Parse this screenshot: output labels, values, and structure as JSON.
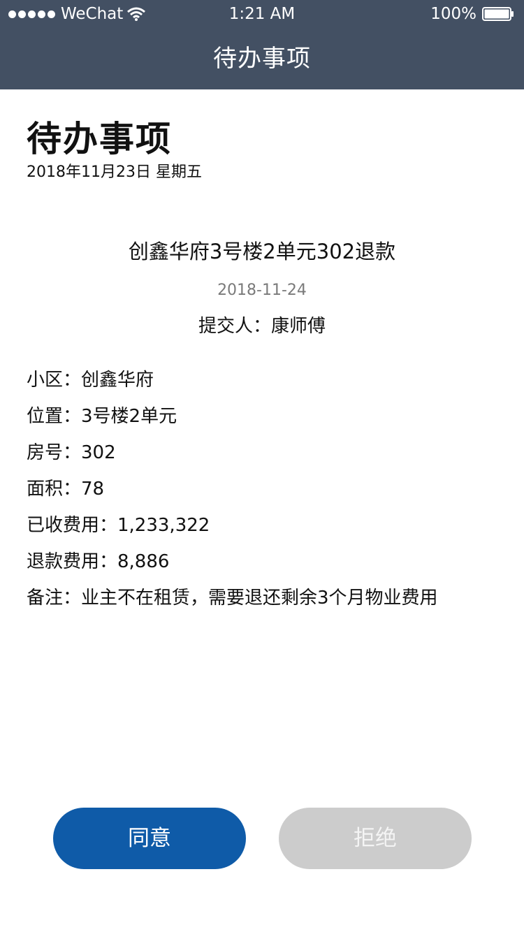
{
  "status_bar": {
    "carrier": "WeChat",
    "time": "1:21 AM",
    "battery": "100%"
  },
  "nav": {
    "title": "待办事项"
  },
  "page": {
    "heading": "待办事项",
    "date": "2018年11月23日 星期五"
  },
  "item": {
    "title": "创鑫华府3号楼2单元302退款",
    "date": "2018-11-24",
    "submitter": "提交人：康师傅"
  },
  "details": [
    "小区：创鑫华府",
    "位置：3号楼2单元",
    "房号：302",
    "面积：78",
    "已收费用：1,233,322",
    "退款费用：8,886",
    "备注：业主不在租赁，需要退还剩余3个月物业费用"
  ],
  "actions": {
    "agree_label": "同意",
    "reject_label": "拒绝"
  },
  "colors": {
    "header_bg": "#435063",
    "agree_bg": "#0f5ba8",
    "reject_bg": "#cccccc"
  }
}
